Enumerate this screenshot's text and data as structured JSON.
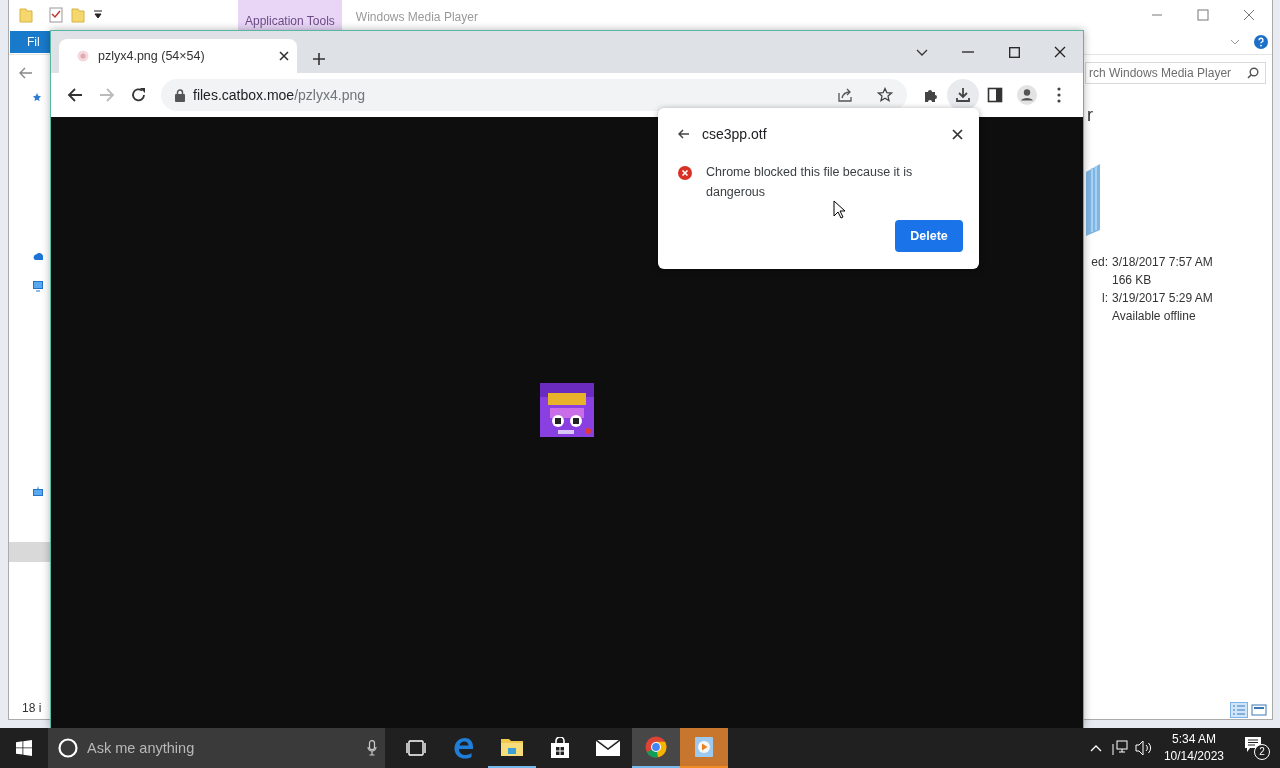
{
  "explorer": {
    "context_tab": "Application Tools",
    "title": "Windows Media Player",
    "file_tab": "Fil",
    "search": {
      "placeholder": "rch Windows Media Player"
    },
    "heading": "r",
    "details": [
      {
        "label": "ed:",
        "value": "3/18/2017 7:57 AM"
      },
      {
        "value": "166 KB"
      },
      {
        "label": "l:",
        "value": "3/19/2017 5:29 AM"
      },
      {
        "value": "Available offline"
      }
    ],
    "status": "18 i"
  },
  "browser": {
    "tabs": [
      {
        "title": "pzlyx4.png (54×54)",
        "selected": true
      }
    ],
    "url": {
      "host": "files.catbox.moe",
      "path": "/pzlyx4.png"
    },
    "download_popup": {
      "filename": "cse3pp.otf",
      "message": "Chrome blocked this file because it is dangerous",
      "button": "Delete"
    }
  },
  "taskbar": {
    "search": {
      "placeholder": "Ask me anything"
    },
    "apps": [
      {
        "kind": "taskview",
        "running": false,
        "selected": false,
        "flashing": false
      },
      {
        "kind": "edge",
        "running": false,
        "selected": false,
        "flashing": false
      },
      {
        "kind": "explorer",
        "running": true,
        "selected": false,
        "flashing": false
      },
      {
        "kind": "store",
        "running": false,
        "selected": false,
        "flashing": false
      },
      {
        "kind": "mail",
        "running": false,
        "selected": false,
        "flashing": false
      },
      {
        "kind": "chrome",
        "running": true,
        "selected": true,
        "flashing": false
      },
      {
        "kind": "mediaplayer",
        "running": true,
        "selected": false,
        "flashing": true
      }
    ],
    "time": "5:34 AM",
    "date": "10/14/2023",
    "notifications": "2"
  }
}
